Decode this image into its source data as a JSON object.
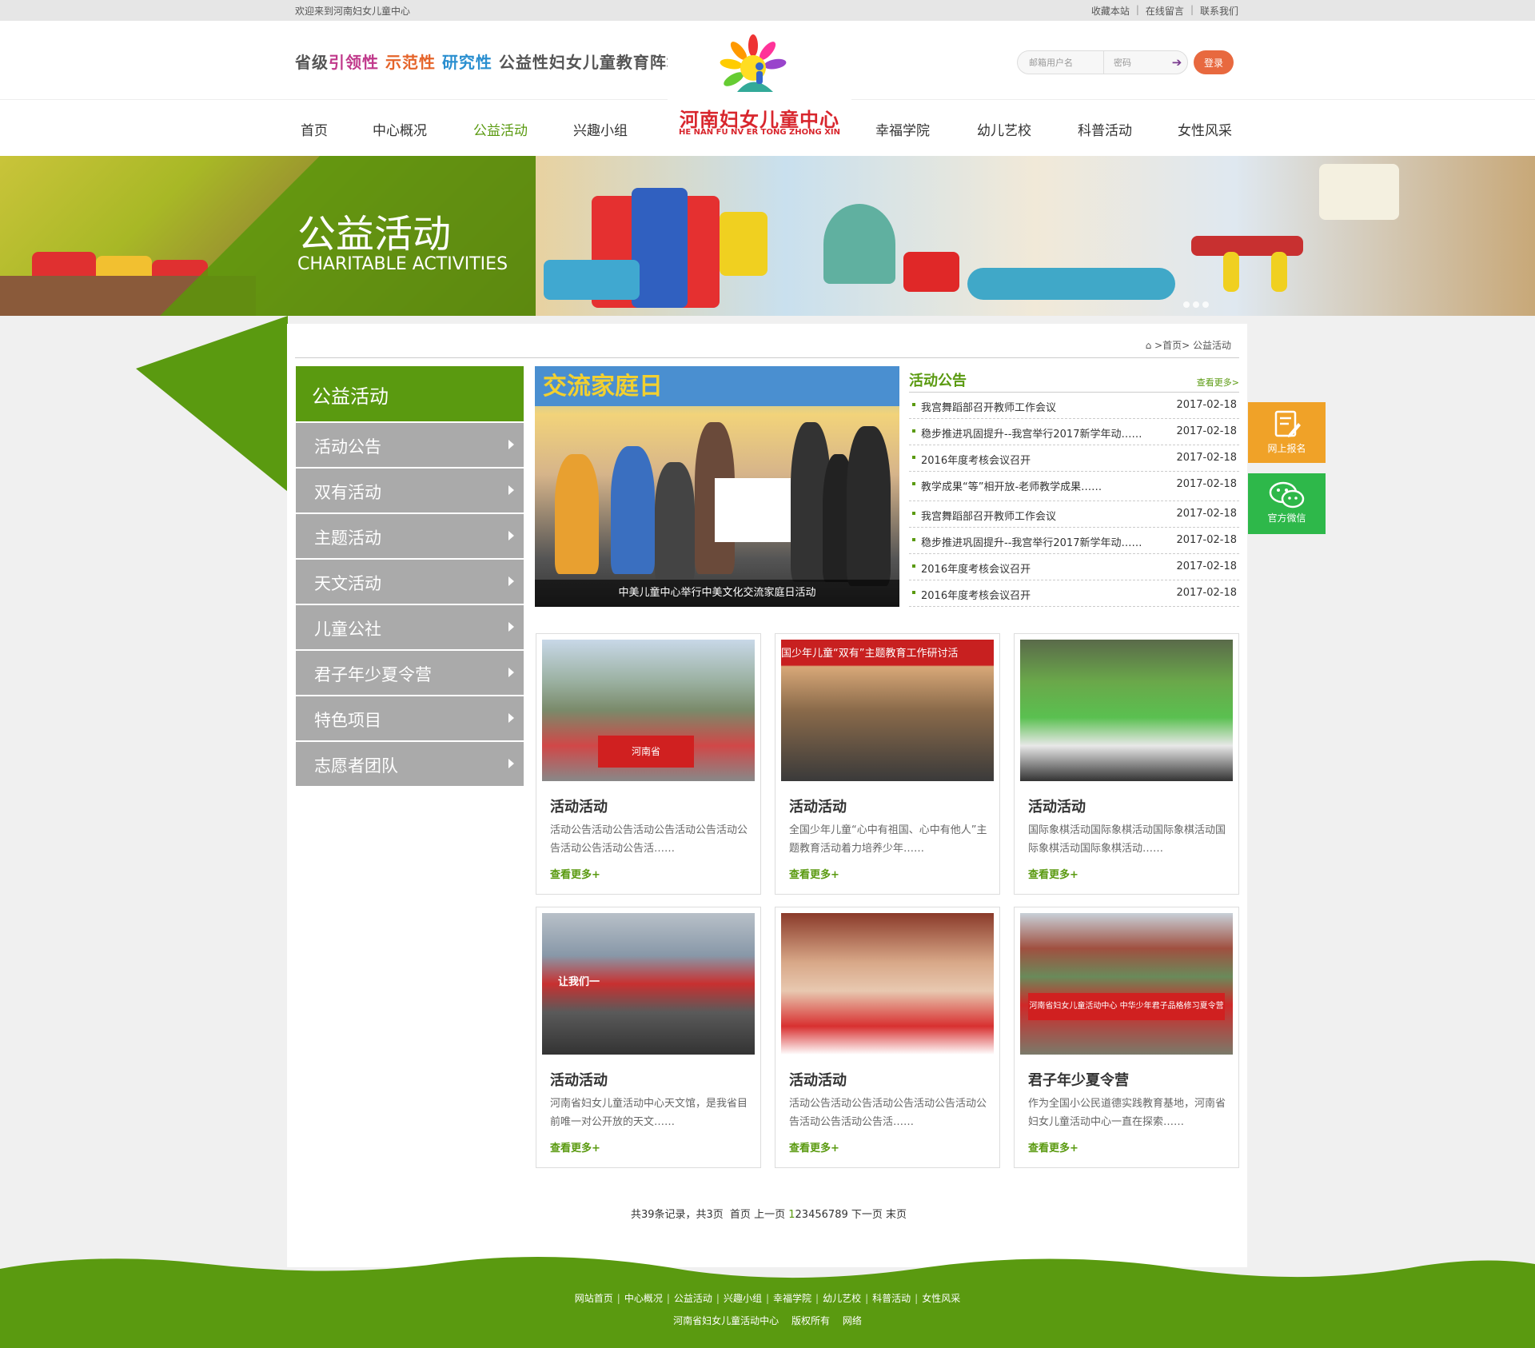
{
  "topbar": {
    "welcome": "欢迎来到河南妇女儿童中心",
    "links": [
      "收藏本站",
      "在线留言",
      "联系我们"
    ]
  },
  "header": {
    "slogan": {
      "p1": "省级",
      "p2": "引领性",
      "p3": "示范性",
      "p4": "研究性",
      "p5": "公益性妇女儿童教育阵地"
    },
    "login": {
      "user_placeholder": "邮箱用户名",
      "pass_placeholder": "密码",
      "button": "登录"
    }
  },
  "logo": {
    "name": "河南妇女儿童中心",
    "pinyin": "HE NAN FU NV ER TONG ZHONG XIN"
  },
  "nav": [
    "首页",
    "中心概况",
    "公益活动",
    "兴趣小组",
    "幸福学院",
    "幼儿艺校",
    "科普活动",
    "女性风采"
  ],
  "banner": {
    "title": "公益活动",
    "subtitle": "CHARITABLE ACTIVITIES"
  },
  "breadcrumb": {
    "home": "首页",
    "sep": ">",
    "current": "公益活动"
  },
  "sidebar": {
    "title": "公益活动",
    "items": [
      "活动公告",
      "双有活动",
      "主题活动",
      "天文活动",
      "儿童公社",
      "君子年少夏令营",
      "特色项目",
      "志愿者团队"
    ]
  },
  "feature": {
    "caption": "中美儿童中心举行中美文化交流家庭日活动",
    "sign": "交流家庭日"
  },
  "notice": {
    "title": "活动公告",
    "more": "查看更多>",
    "rows": [
      {
        "text": "我宫舞蹈部召开教师工作会议",
        "date": "2017-02-18"
      },
      {
        "text": "稳步推进巩固提升--我宫举行2017新学年动……",
        "date": "2017-02-18"
      },
      {
        "text": "2016年度考核会议召开",
        "date": "2017-02-18"
      },
      {
        "text": "教学成果“等”相开放-老师教学成果……",
        "date": "2017-02-18"
      },
      {
        "text": "我宫舞蹈部召开教师工作会议",
        "date": "2017-02-18"
      },
      {
        "text": "稳步推进巩固提升--我宫举行2017新学年动……",
        "date": "2017-02-18"
      },
      {
        "text": "2016年度考核会议召开",
        "date": "2017-02-18"
      },
      {
        "text": "2016年度考核会议召开",
        "date": "2017-02-18"
      }
    ]
  },
  "cards": [
    {
      "title": "活动活动",
      "desc": "活动公告活动公告活动公告活动公告活动公告活动公告活动公告活……",
      "more": "查看更多+",
      "img_text": "河南省"
    },
    {
      "title": "活动活动",
      "desc": "全国少年儿童“心中有祖国、心中有他人”主题教育活动着力培养少年……",
      "more": "查看更多+",
      "img_text": "国少年儿童“双有”主题教育工作研讨活"
    },
    {
      "title": "活动活动",
      "desc": "国际象棋活动国际象棋活动国际象棋活动国际象棋活动国际象棋活动……",
      "more": "查看更多+",
      "img_text": ""
    },
    {
      "title": "活动活动",
      "desc": "河南省妇女儿童活动中心天文馆，是我省目前唯一对公开放的天文……",
      "more": "查看更多+",
      "img_text": "让我们一"
    },
    {
      "title": "活动活动",
      "desc": "活动公告活动公告活动公告活动公告活动公告活动公告活动公告活……",
      "more": "查看更多+",
      "img_text": ""
    },
    {
      "title": "君子年少夏令营",
      "desc": "作为全国小公民道德实践教育基地，河南省妇女儿童活动中心一直在探索……",
      "more": "查看更多+",
      "img_text": "河南省妇女儿童活动中心 中华少年君子品格修习夏令营"
    }
  ],
  "pager": {
    "summary": "共39条记录，共3页",
    "first": "首页",
    "prev": "上一页",
    "pages": [
      "1",
      "2",
      "3",
      "4",
      "5",
      "6",
      "7",
      "8",
      "9"
    ],
    "next": "下一页",
    "last": "末页"
  },
  "float": {
    "signup": "网上报名",
    "wechat": "官方微信"
  },
  "footer": {
    "links": [
      "网站首页",
      "中心概况",
      "公益活动",
      "兴趣小组",
      "幸福学院",
      "幼儿艺校",
      "科普活动",
      "女性风采"
    ],
    "copy": [
      "河南省妇女儿童活动中心",
      "版权所有",
      "网络"
    ]
  },
  "colors": {
    "brand_green": "#5a9a10",
    "accent_orange": "#e8693f",
    "signup_orange": "#f0a228",
    "wechat_green": "#2eb84a",
    "logo_red": "#d8262d"
  }
}
